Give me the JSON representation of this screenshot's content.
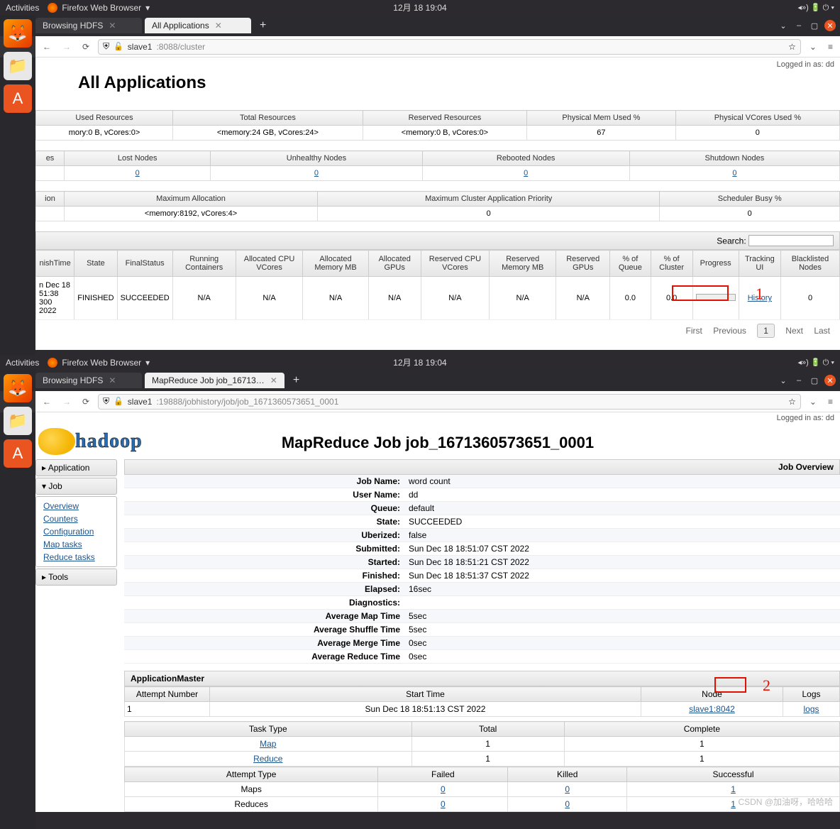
{
  "topbar": {
    "activities": "Activities",
    "app": "Firefox Web Browser",
    "datetime": "12月 18  19:04"
  },
  "dock": {
    "firefox": "firefox-icon",
    "files": "files-icon",
    "software": "software-icon"
  },
  "screen1": {
    "tabs": [
      {
        "label": "Browsing HDFS"
      },
      {
        "label": "All Applications"
      }
    ],
    "url_host": "slave1",
    "url_path": ":8088/cluster",
    "login": "Logged in as: dd",
    "title": "All Applications",
    "resources": {
      "headers": [
        "Used Resources",
        "Total Resources",
        "Reserved Resources",
        "Physical Mem Used %",
        "Physical VCores Used %"
      ],
      "row": [
        "mory:0 B, vCores:0>",
        "<memory:24 GB, vCores:24>",
        "<memory:0 B, vCores:0>",
        "67",
        "0"
      ]
    },
    "nodes": {
      "headers": [
        "es",
        "Lost Nodes",
        "Unhealthy Nodes",
        "Rebooted Nodes",
        "Shutdown Nodes"
      ],
      "row": [
        "",
        "0",
        "0",
        "0",
        "0"
      ]
    },
    "alloc": {
      "headers": [
        "ion",
        "Maximum Allocation",
        "Maximum Cluster Application Priority",
        "Scheduler Busy %"
      ],
      "row": [
        "",
        "<memory:8192, vCores:4>",
        "0",
        "0"
      ]
    },
    "search_label": "Search:",
    "app_headers": [
      "nishTime",
      "State",
      "FinalStatus",
      "Running Containers",
      "Allocated CPU VCores",
      "Allocated Memory MB",
      "Allocated GPUs",
      "Reserved CPU VCores",
      "Reserved Memory MB",
      "Reserved GPUs",
      "% of Queue",
      "% of Cluster",
      "Progress",
      "Tracking UI",
      "Blacklisted Nodes"
    ],
    "app_row": {
      "finish": "n Dec 18\n51:38\n300 2022",
      "state": "FINISHED",
      "final": "SUCCEEDED",
      "rc": "N/A",
      "cpu": "N/A",
      "mem": "N/A",
      "gpu": "N/A",
      "rcpu": "N/A",
      "rmem": "N/A",
      "rgpu": "N/A",
      "pq": "0.0",
      "pc": "0.0",
      "tracking": "History",
      "bl": "0"
    },
    "pager": {
      "first": "First",
      "prev": "Previous",
      "cur": "1",
      "next": "Next",
      "last": "Last"
    },
    "annotation": "1"
  },
  "screen2": {
    "tabs": [
      {
        "label": "Browsing HDFS"
      },
      {
        "label": "MapReduce Job job_16713…"
      }
    ],
    "url_host": "slave1",
    "url_path": ":19888/jobhistory/job/job_1671360573651_0001",
    "login": "Logged in as: dd",
    "logo_text": "hadoop",
    "title": "MapReduce Job job_1671360573651_0001",
    "side": {
      "application": "Application",
      "job": "Job",
      "links": [
        "Overview",
        "Counters",
        "Configuration",
        "Map tasks",
        "Reduce tasks"
      ],
      "tools": "Tools"
    },
    "overview_label": "Job Overview",
    "kv": [
      {
        "k": "Job Name:",
        "v": "word count"
      },
      {
        "k": "User Name:",
        "v": "dd"
      },
      {
        "k": "Queue:",
        "v": "default"
      },
      {
        "k": "State:",
        "v": "SUCCEEDED"
      },
      {
        "k": "Uberized:",
        "v": "false"
      },
      {
        "k": "Submitted:",
        "v": "Sun Dec 18 18:51:07 CST 2022"
      },
      {
        "k": "Started:",
        "v": "Sun Dec 18 18:51:21 CST 2022"
      },
      {
        "k": "Finished:",
        "v": "Sun Dec 18 18:51:37 CST 2022"
      },
      {
        "k": "Elapsed:",
        "v": "16sec"
      },
      {
        "k": "Diagnostics:",
        "v": ""
      },
      {
        "k": "Average Map Time",
        "v": "5sec"
      },
      {
        "k": "Average Shuffle Time",
        "v": "5sec"
      },
      {
        "k": "Average Merge Time",
        "v": "0sec"
      },
      {
        "k": "Average Reduce Time",
        "v": "0sec"
      }
    ],
    "am_label": "ApplicationMaster",
    "am_headers": [
      "Attempt Number",
      "Start Time",
      "Node",
      "Logs"
    ],
    "am_row": {
      "num": "1",
      "start": "Sun Dec 18 18:51:13 CST 2022",
      "node": "slave1:8042",
      "logs": "logs"
    },
    "task_headers": [
      "Task Type",
      "Total",
      "Complete"
    ],
    "task_rows": [
      {
        "type": "Map",
        "total": "1",
        "complete": "1"
      },
      {
        "type": "Reduce",
        "total": "1",
        "complete": "1"
      }
    ],
    "attempt_headers": [
      "Attempt Type",
      "Failed",
      "Killed",
      "Successful"
    ],
    "attempt_rows": [
      {
        "type": "Maps",
        "f": "0",
        "k": "0",
        "s": "1"
      },
      {
        "type": "Reduces",
        "f": "0",
        "k": "0",
        "s": "1"
      }
    ],
    "annotation": "2",
    "watermark": "CSDN @加油呀，哈哈哈"
  }
}
